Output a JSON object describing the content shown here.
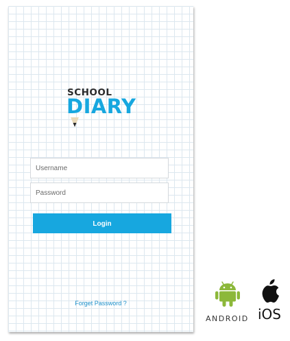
{
  "logo": {
    "top_text": "SCHOOL",
    "main_text": "DIARY",
    "brand_color": "#17a7df",
    "icon": "pencil-icon"
  },
  "login_form": {
    "username_placeholder": "Username",
    "password_placeholder": "Password",
    "login_label": "Login",
    "forgot_password_label": "Forget Password ?"
  },
  "platforms": {
    "android": {
      "label": "ANDROID",
      "icon": "android-robot-icon",
      "color": "#8cb83a"
    },
    "ios": {
      "label": "iOS",
      "icon": "apple-icon",
      "color": "#111111"
    }
  }
}
